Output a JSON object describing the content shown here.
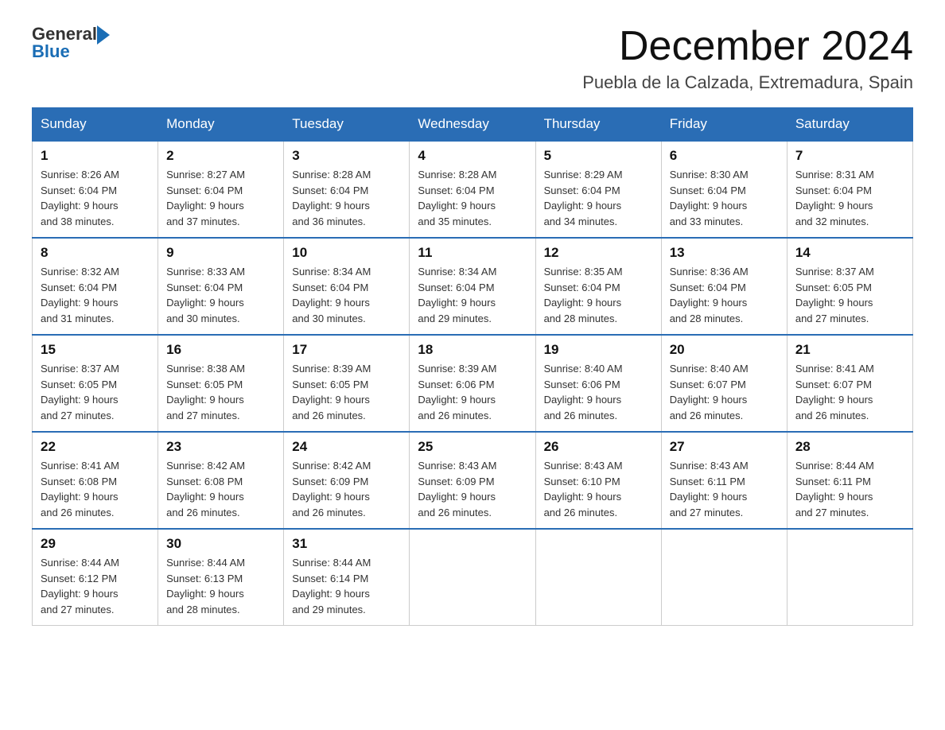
{
  "header": {
    "logo_general": "General",
    "logo_blue": "Blue",
    "title": "December 2024",
    "location": "Puebla de la Calzada, Extremadura, Spain"
  },
  "weekdays": [
    "Sunday",
    "Monday",
    "Tuesday",
    "Wednesday",
    "Thursday",
    "Friday",
    "Saturday"
  ],
  "weeks": [
    [
      {
        "day": "1",
        "sunrise": "8:26 AM",
        "sunset": "6:04 PM",
        "daylight": "9 hours and 38 minutes."
      },
      {
        "day": "2",
        "sunrise": "8:27 AM",
        "sunset": "6:04 PM",
        "daylight": "9 hours and 37 minutes."
      },
      {
        "day": "3",
        "sunrise": "8:28 AM",
        "sunset": "6:04 PM",
        "daylight": "9 hours and 36 minutes."
      },
      {
        "day": "4",
        "sunrise": "8:28 AM",
        "sunset": "6:04 PM",
        "daylight": "9 hours and 35 minutes."
      },
      {
        "day": "5",
        "sunrise": "8:29 AM",
        "sunset": "6:04 PM",
        "daylight": "9 hours and 34 minutes."
      },
      {
        "day": "6",
        "sunrise": "8:30 AM",
        "sunset": "6:04 PM",
        "daylight": "9 hours and 33 minutes."
      },
      {
        "day": "7",
        "sunrise": "8:31 AM",
        "sunset": "6:04 PM",
        "daylight": "9 hours and 32 minutes."
      }
    ],
    [
      {
        "day": "8",
        "sunrise": "8:32 AM",
        "sunset": "6:04 PM",
        "daylight": "9 hours and 31 minutes."
      },
      {
        "day": "9",
        "sunrise": "8:33 AM",
        "sunset": "6:04 PM",
        "daylight": "9 hours and 30 minutes."
      },
      {
        "day": "10",
        "sunrise": "8:34 AM",
        "sunset": "6:04 PM",
        "daylight": "9 hours and 30 minutes."
      },
      {
        "day": "11",
        "sunrise": "8:34 AM",
        "sunset": "6:04 PM",
        "daylight": "9 hours and 29 minutes."
      },
      {
        "day": "12",
        "sunrise": "8:35 AM",
        "sunset": "6:04 PM",
        "daylight": "9 hours and 28 minutes."
      },
      {
        "day": "13",
        "sunrise": "8:36 AM",
        "sunset": "6:04 PM",
        "daylight": "9 hours and 28 minutes."
      },
      {
        "day": "14",
        "sunrise": "8:37 AM",
        "sunset": "6:05 PM",
        "daylight": "9 hours and 27 minutes."
      }
    ],
    [
      {
        "day": "15",
        "sunrise": "8:37 AM",
        "sunset": "6:05 PM",
        "daylight": "9 hours and 27 minutes."
      },
      {
        "day": "16",
        "sunrise": "8:38 AM",
        "sunset": "6:05 PM",
        "daylight": "9 hours and 27 minutes."
      },
      {
        "day": "17",
        "sunrise": "8:39 AM",
        "sunset": "6:05 PM",
        "daylight": "9 hours and 26 minutes."
      },
      {
        "day": "18",
        "sunrise": "8:39 AM",
        "sunset": "6:06 PM",
        "daylight": "9 hours and 26 minutes."
      },
      {
        "day": "19",
        "sunrise": "8:40 AM",
        "sunset": "6:06 PM",
        "daylight": "9 hours and 26 minutes."
      },
      {
        "day": "20",
        "sunrise": "8:40 AM",
        "sunset": "6:07 PM",
        "daylight": "9 hours and 26 minutes."
      },
      {
        "day": "21",
        "sunrise": "8:41 AM",
        "sunset": "6:07 PM",
        "daylight": "9 hours and 26 minutes."
      }
    ],
    [
      {
        "day": "22",
        "sunrise": "8:41 AM",
        "sunset": "6:08 PM",
        "daylight": "9 hours and 26 minutes."
      },
      {
        "day": "23",
        "sunrise": "8:42 AM",
        "sunset": "6:08 PM",
        "daylight": "9 hours and 26 minutes."
      },
      {
        "day": "24",
        "sunrise": "8:42 AM",
        "sunset": "6:09 PM",
        "daylight": "9 hours and 26 minutes."
      },
      {
        "day": "25",
        "sunrise": "8:43 AM",
        "sunset": "6:09 PM",
        "daylight": "9 hours and 26 minutes."
      },
      {
        "day": "26",
        "sunrise": "8:43 AM",
        "sunset": "6:10 PM",
        "daylight": "9 hours and 26 minutes."
      },
      {
        "day": "27",
        "sunrise": "8:43 AM",
        "sunset": "6:11 PM",
        "daylight": "9 hours and 27 minutes."
      },
      {
        "day": "28",
        "sunrise": "8:44 AM",
        "sunset": "6:11 PM",
        "daylight": "9 hours and 27 minutes."
      }
    ],
    [
      {
        "day": "29",
        "sunrise": "8:44 AM",
        "sunset": "6:12 PM",
        "daylight": "9 hours and 27 minutes."
      },
      {
        "day": "30",
        "sunrise": "8:44 AM",
        "sunset": "6:13 PM",
        "daylight": "9 hours and 28 minutes."
      },
      {
        "day": "31",
        "sunrise": "8:44 AM",
        "sunset": "6:14 PM",
        "daylight": "9 hours and 29 minutes."
      },
      null,
      null,
      null,
      null
    ]
  ],
  "labels": {
    "sunrise": "Sunrise:",
    "sunset": "Sunset:",
    "daylight": "Daylight:"
  }
}
